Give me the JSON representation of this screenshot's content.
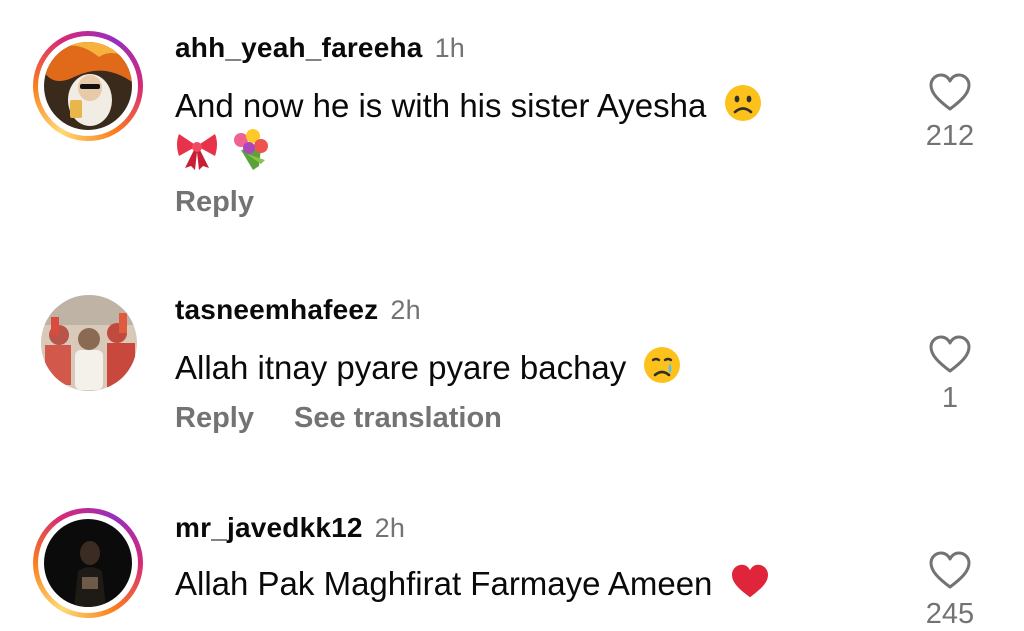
{
  "comments": [
    {
      "username": "ahh_yeah_fareeha",
      "time": "1h",
      "text": "And now he is with his sister Ayesha",
      "emoji_after_text": "slightly-frowning-face",
      "extra_emojis": [
        "ribbon",
        "bouquet"
      ],
      "actions": [
        "Reply"
      ],
      "likes": "212",
      "has_story_ring": true
    },
    {
      "username": "tasneemhafeez",
      "time": "2h",
      "text": "Allah itnay pyare pyare bachay",
      "emoji_after_text": "crying-face",
      "actions": [
        "Reply",
        "See translation"
      ],
      "likes": "1",
      "has_story_ring": false
    },
    {
      "username": "mr_javedkk12",
      "time": "2h",
      "text": "Allah Pak Maghfirat Farmaye Ameen",
      "emoji_after_text": "red-heart",
      "actions": [],
      "likes": "245",
      "has_story_ring": true
    }
  ],
  "colors": {
    "secondary_text": "#737373",
    "primary_text": "#0a0a0a",
    "heart_red": "#e0243a"
  }
}
